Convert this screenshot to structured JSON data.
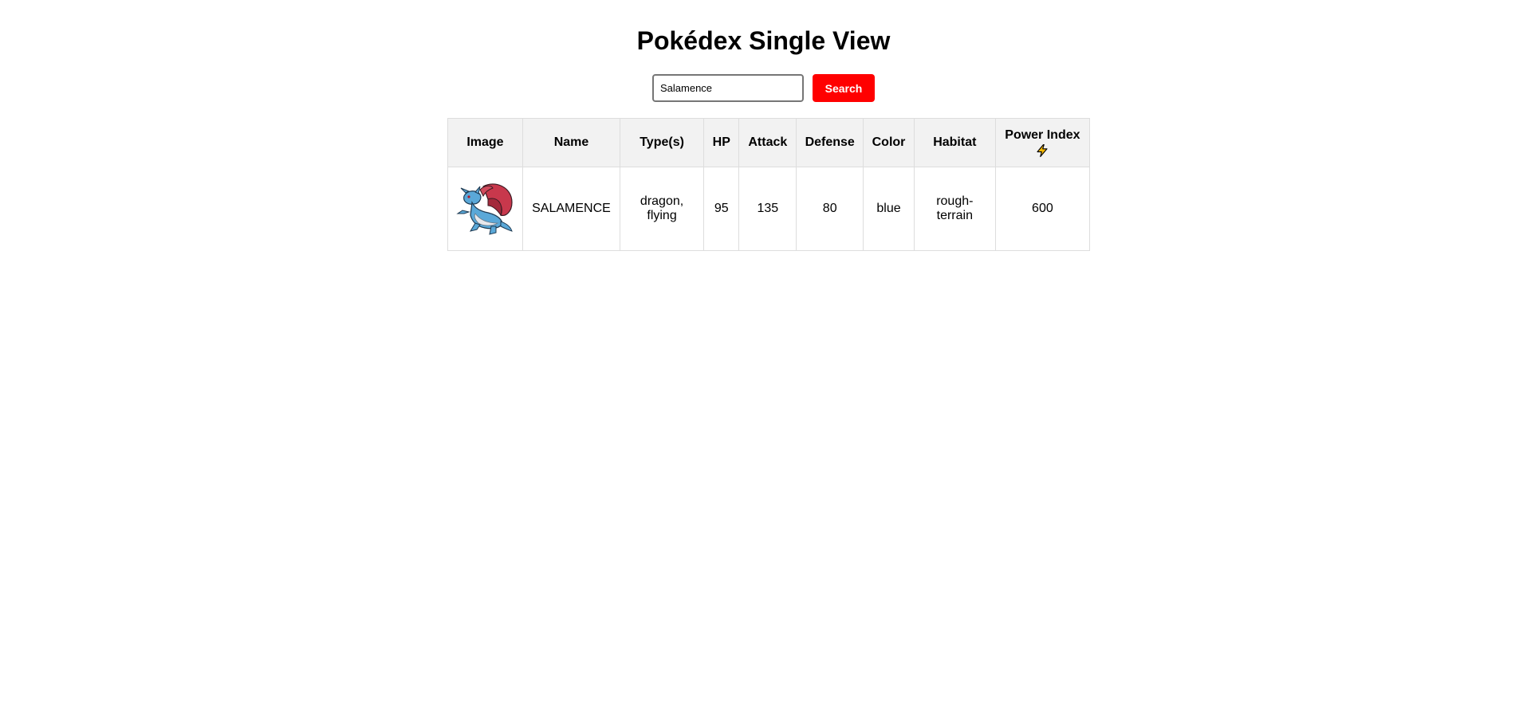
{
  "page": {
    "title": "Pokédex Single View"
  },
  "search": {
    "value": "Salamence",
    "button_label": "Search"
  },
  "table": {
    "headers": {
      "image": "Image",
      "name": "Name",
      "types": "Type(s)",
      "hp": "HP",
      "attack": "Attack",
      "defense": "Defense",
      "color": "Color",
      "habitat": "Habitat",
      "power_index": "Power Index",
      "power_icon": "lightning-bolt-icon"
    },
    "row": {
      "image": "salamence-sprite",
      "name": "SALAMENCE",
      "types": "dragon, flying",
      "hp": "95",
      "attack": "135",
      "defense": "80",
      "color": "blue",
      "habitat": "rough-terrain",
      "power_index": "600"
    }
  },
  "colors": {
    "accent": "#ff0000",
    "header_bg": "#f2f2f2",
    "border": "#dddddd",
    "bolt_fill": "#f5b800"
  }
}
